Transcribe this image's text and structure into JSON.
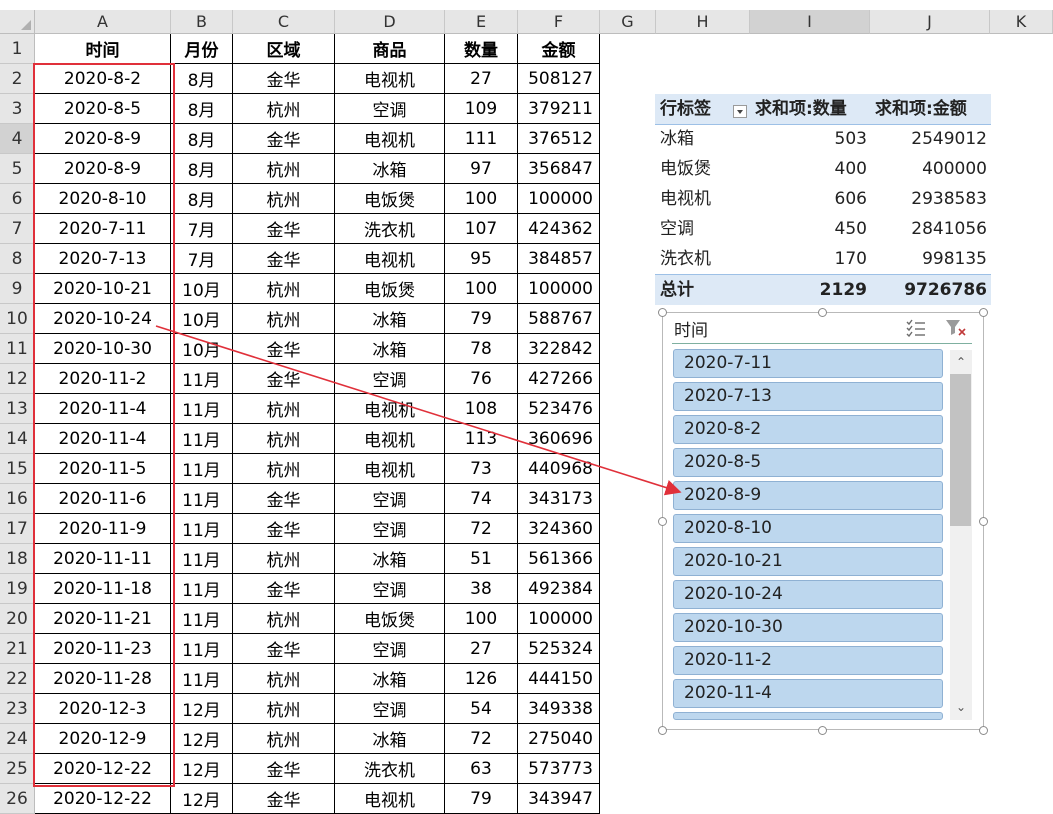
{
  "sheet": {
    "columns": [
      "A",
      "B",
      "C",
      "D",
      "E",
      "F",
      "G",
      "H",
      "I",
      "J",
      "K"
    ],
    "rows": [
      "1",
      "2",
      "3",
      "4",
      "5",
      "6",
      "7",
      "8",
      "9",
      "10",
      "11",
      "12",
      "13",
      "14",
      "15",
      "16",
      "17",
      "18",
      "19",
      "20",
      "21",
      "22",
      "23",
      "24",
      "25",
      "26"
    ],
    "headers": [
      "时间",
      "月份",
      "区域",
      "商品",
      "数量",
      "金额"
    ],
    "data": [
      [
        "2020-8-2",
        "8月",
        "金华",
        "电视机",
        "27",
        "508127"
      ],
      [
        "2020-8-5",
        "8月",
        "杭州",
        "空调",
        "109",
        "379211"
      ],
      [
        "2020-8-9",
        "8月",
        "金华",
        "电视机",
        "111",
        "376512"
      ],
      [
        "2020-8-9",
        "8月",
        "杭州",
        "冰箱",
        "97",
        "356847"
      ],
      [
        "2020-8-10",
        "8月",
        "杭州",
        "电饭煲",
        "100",
        "100000"
      ],
      [
        "2020-7-11",
        "7月",
        "金华",
        "洗衣机",
        "107",
        "424362"
      ],
      [
        "2020-7-13",
        "7月",
        "金华",
        "电视机",
        "95",
        "384857"
      ],
      [
        "2020-10-21",
        "10月",
        "杭州",
        "电饭煲",
        "100",
        "100000"
      ],
      [
        "2020-10-24",
        "10月",
        "杭州",
        "冰箱",
        "79",
        "588767"
      ],
      [
        "2020-10-30",
        "10月",
        "金华",
        "冰箱",
        "78",
        "322842"
      ],
      [
        "2020-11-2",
        "11月",
        "金华",
        "空调",
        "76",
        "427266"
      ],
      [
        "2020-11-4",
        "11月",
        "杭州",
        "电视机",
        "108",
        "523476"
      ],
      [
        "2020-11-4",
        "11月",
        "杭州",
        "电视机",
        "113",
        "360696"
      ],
      [
        "2020-11-5",
        "11月",
        "杭州",
        "电视机",
        "73",
        "440968"
      ],
      [
        "2020-11-6",
        "11月",
        "金华",
        "空调",
        "74",
        "343173"
      ],
      [
        "2020-11-9",
        "11月",
        "金华",
        "空调",
        "72",
        "324360"
      ],
      [
        "2020-11-11",
        "11月",
        "杭州",
        "冰箱",
        "51",
        "561366"
      ],
      [
        "2020-11-18",
        "11月",
        "金华",
        "空调",
        "38",
        "492384"
      ],
      [
        "2020-11-21",
        "11月",
        "杭州",
        "电饭煲",
        "100",
        "100000"
      ],
      [
        "2020-11-23",
        "11月",
        "金华",
        "空调",
        "27",
        "525324"
      ],
      [
        "2020-11-28",
        "11月",
        "杭州",
        "冰箱",
        "126",
        "444150"
      ],
      [
        "2020-12-3",
        "12月",
        "杭州",
        "空调",
        "54",
        "349338"
      ],
      [
        "2020-12-9",
        "12月",
        "杭州",
        "冰箱",
        "72",
        "275040"
      ],
      [
        "2020-12-22",
        "12月",
        "金华",
        "洗衣机",
        "63",
        "573773"
      ],
      [
        "2020-12-22",
        "12月",
        "金华",
        "电视机",
        "79",
        "343947"
      ]
    ]
  },
  "pivot": {
    "row_label": "行标签",
    "sum_qty": "求和项:数量",
    "sum_amt": "求和项:金额",
    "rows": [
      {
        "name": "冰箱",
        "qty": "503",
        "amt": "2549012"
      },
      {
        "name": "电饭煲",
        "qty": "400",
        "amt": "400000"
      },
      {
        "name": "电视机",
        "qty": "606",
        "amt": "2938583"
      },
      {
        "name": "空调",
        "qty": "450",
        "amt": "2841056"
      },
      {
        "name": "洗衣机",
        "qty": "170",
        "amt": "998135"
      }
    ],
    "total_label": "总计",
    "total_qty": "2129",
    "total_amt": "9726786"
  },
  "slicer": {
    "title": "时间",
    "items": [
      "2020-7-11",
      "2020-7-13",
      "2020-8-2",
      "2020-8-5",
      "2020-8-9",
      "2020-8-10",
      "2020-10-21",
      "2020-10-24",
      "2020-10-30",
      "2020-11-2",
      "2020-11-4"
    ],
    "icons": [
      "multi-select-icon",
      "clear-filter-icon"
    ]
  },
  "colors": {
    "highlight_box": "#e0303a",
    "arrow": "#e0303a",
    "pivot_header_bg": "#dde9f6",
    "slicer_item_bg": "#bdd7ee"
  }
}
